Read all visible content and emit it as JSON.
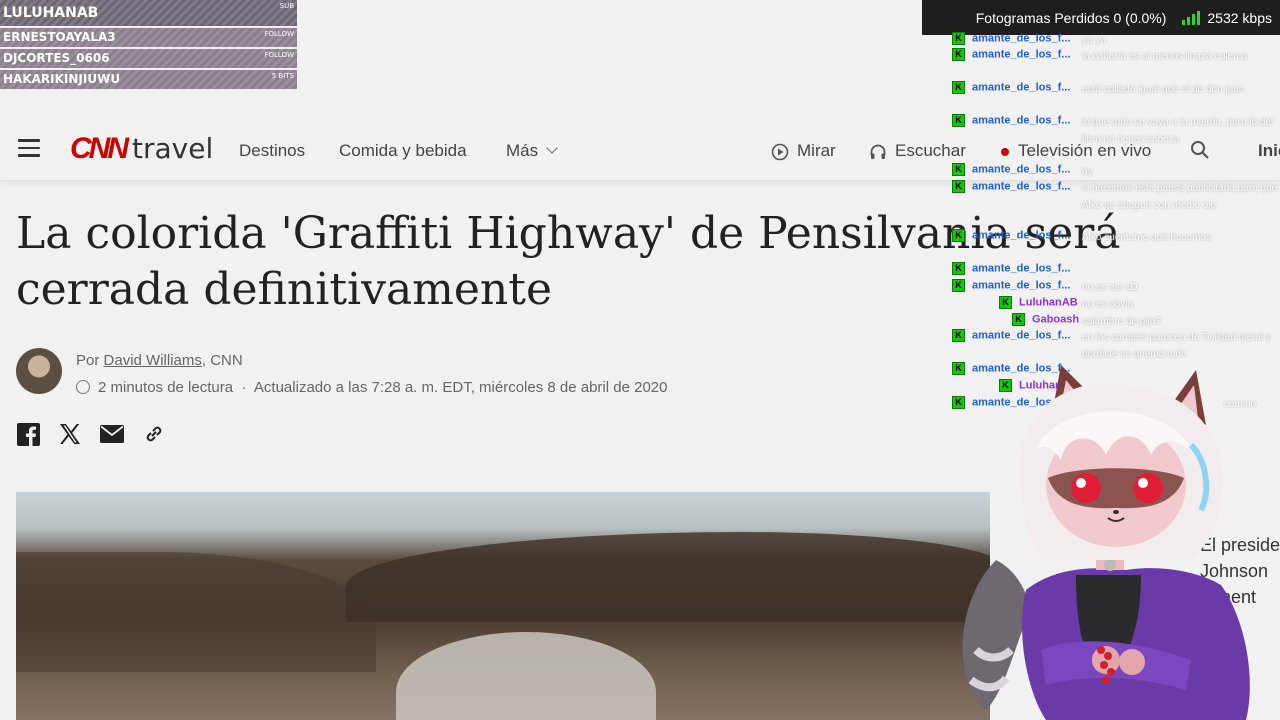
{
  "alerts": [
    {
      "name": "LULUHANAB",
      "tag": "SUB"
    },
    {
      "name": "ERNESTOAYALA3",
      "tag": "FOLLOW"
    },
    {
      "name": "DJCORTES_0606",
      "tag": "FOLLOW"
    },
    {
      "name": "HAKARIKINJIUWU",
      "tag": "5 BITS"
    }
  ],
  "stats": {
    "frames_lost": "Fotogramas Perdidos 0 (0.0%)",
    "bitrate": "2532 kbps",
    "signal_color": "#36d13a"
  },
  "header": {
    "logo_brand": "CNN",
    "logo_section": "travel",
    "nav": [
      "Destinos",
      "Comida y bebida",
      "Más"
    ],
    "watch": "Mirar",
    "listen": "Escuchar",
    "live_tv": "Televisión en vivo",
    "login": "Iniciar",
    "accent": "#cc0000"
  },
  "article": {
    "headline": "La colorida 'Graffiti Highway' de Pensilvania será cerrada definitivamente",
    "byline_prefix": "Por ",
    "author": "David Williams",
    "byline_suffix": ", CNN",
    "read_time": "2 minutos de lectura",
    "updated": "Actualizado a las 7:28 a. m. EDT, miércoles 8 de abril de 2020",
    "side_text": [
      "El preside",
      "Johnson",
      "rament"
    ]
  },
  "share": [
    "facebook-icon",
    "x-icon",
    "email-icon",
    "link-icon"
  ],
  "chat": [
    {
      "user": "amante_de_los_f...",
      "text": "ya ya"
    },
    {
      "user": "amante_de_los_f...",
      "text": "la cañería es al menos limpia eulerca"
    },
    {
      "user": "amante_de_los_f...",
      "text": "está callado igual que el de don juan"
    },
    {
      "user": "amante_de_los_f...",
      "text": "lo que todo se vaya a la mierda, pero lo del libro no tienes cabeza"
    },
    {
      "user": "amante_de_los_f...",
      "text": "ay"
    },
    {
      "user": "amante_de_los_f...",
      "text": "si hacemos esta pausa publicitaria para que Alko se apague con medio ojo"
    },
    {
      "user": "amante_de_los_f...",
      "text": "Alko cuéntame qué hacemos"
    },
    {
      "user": "amante_de_los_f...",
      "text": ""
    },
    {
      "user": "amante_de_los_f...",
      "text": "no es así xD"
    },
    {
      "user": "LuluhanAB",
      "text": "no es obvio"
    },
    {
      "user": "Gaboash",
      "text": "calambre de pija?"
    },
    {
      "user": "amante_de_los_f...",
      "text": "en los carteles parecen de Twisted metal y perdiste se quemó todo"
    },
    {
      "user": "amante_de_los_f...",
      "text": ""
    },
    {
      "user": "LuluhanAB",
      "text": ""
    },
    {
      "user": "amante_de_los_f...",
      "text": "camino"
    }
  ]
}
